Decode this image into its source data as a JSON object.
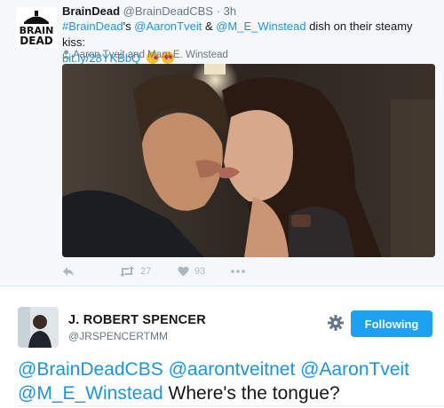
{
  "tweet1": {
    "display_name": "BrainDead",
    "handle": "@BrainDeadCBS",
    "separator": "·",
    "time": "3h",
    "text": {
      "hashtag": "#BrainDead",
      "possessive": "'s",
      "mention1": "@AaronTveit",
      "amp": " & ",
      "mention2": "@M_E_Winstead",
      "rest": " dish on their steamy kiss:",
      "link": "bit.ly/28YKBbQ"
    },
    "emojis": [
      "face-blowing-kiss",
      "smiling-face-with-hearts"
    ],
    "tagged": "Aaron Tveit and Mary E. Winstead",
    "logo_text": "BRAIN DEAD",
    "retweet_count": "27",
    "like_count": "93",
    "icons": [
      "reply-icon",
      "retweet-icon",
      "heart-icon",
      "more-icon"
    ]
  },
  "tweet2": {
    "display_name": "J. ROBERT SPENCER",
    "handle": "@JRSPENCERTMM",
    "follow_button": "Following",
    "text": {
      "mention1": "@BrainDeadCBS",
      "mention2": "@aarontveitnet",
      "mention3": "@AaronTveit",
      "mention4": "@M_E_Winstead",
      "rest": " Where's the tongue?"
    }
  },
  "colors": {
    "link": "#1b95e0",
    "follow_button": "#1da1f2",
    "muted": "#657786",
    "action_icons": "#aab8c2",
    "top_background": "#f5f8fa"
  }
}
